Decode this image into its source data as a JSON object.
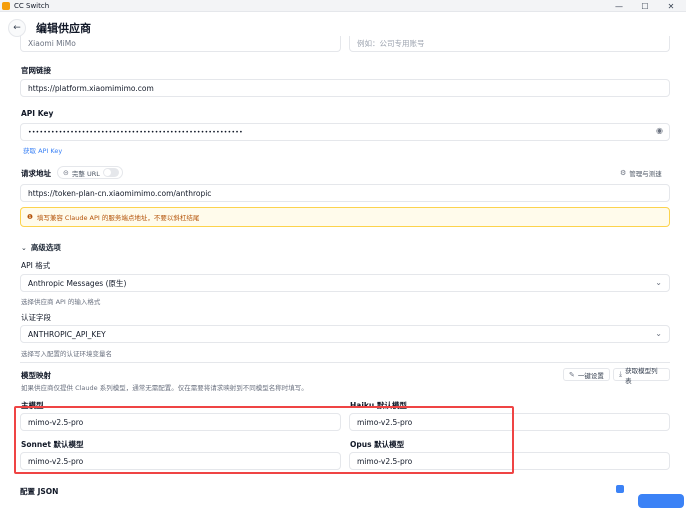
{
  "window": {
    "title": "CC Switch"
  },
  "header": {
    "title": "编辑供应商"
  },
  "top_fields": {
    "name_value": "Xiaomi MiMo",
    "notes_value": "例如：公司专用账号"
  },
  "website": {
    "label": "官网链接",
    "value": "https://platform.xiaomimimo.com"
  },
  "api_key": {
    "label": "API Key",
    "value": "••••••••••••••••••••••••••••••••••••••••••••••••••••••••",
    "get_link": "获取 API Key"
  },
  "endpoint": {
    "label": "请求地址",
    "full_url_label": "完整 URL",
    "manage_label": "管理与测速",
    "value": "https://token-plan-cn.xiaomimimo.com/anthropic",
    "warning": "填写兼容 Claude API 的服务端点地址，不要以斜杠结尾"
  },
  "advanced": {
    "title": "高级选项",
    "api_format_label": "API 格式",
    "api_format_value": "Anthropic Messages (原生)",
    "api_format_hint": "选择供应商 API 的输入格式",
    "auth_label": "认证字段",
    "auth_value": "ANTHROPIC_API_KEY",
    "auth_hint": "选择写入配置的认证环境变量名"
  },
  "model_mapping": {
    "title": "模型映射",
    "hint": "如果供应商仅提供 Claude 系列模型，通常无需配置。仅在需要将请求映射到不同模型名称时填写。",
    "one_click_label": "一键设置",
    "fetch_label": "获取模型列表",
    "main_label": "主模型",
    "main_value": "mimo-v2.5-pro",
    "haiku_label": "Haiku 默认模型",
    "haiku_value": "mimo-v2.5-pro",
    "sonnet_label": "Sonnet 默认模型",
    "sonnet_value": "mimo-v2.5-pro",
    "opus_label": "Opus 默认模型",
    "opus_value": "mimo-v2.5-pro"
  },
  "bottom": {
    "config_label": "配置 JSON"
  }
}
